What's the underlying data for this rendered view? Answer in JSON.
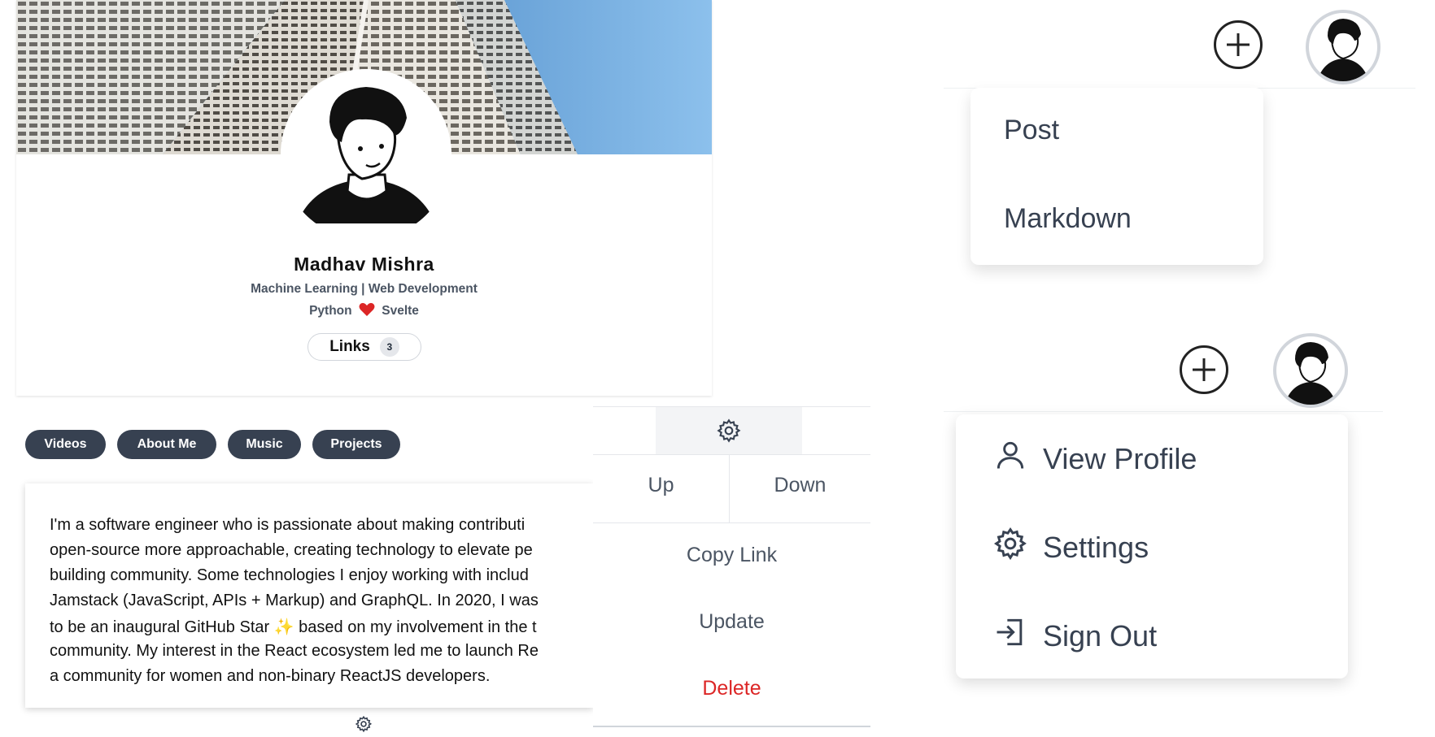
{
  "profile": {
    "name": "Madhav Mishra",
    "subtitle": "Machine Learning | Web Development",
    "tag_left": "Python",
    "tag_right": "Svelte",
    "links_label": "Links",
    "links_count": "3"
  },
  "tabs": [
    "Videos",
    "About Me",
    "Music",
    "Projects"
  ],
  "about": {
    "lines": [
      "I'm a software engineer who is passionate about making contributi",
      "open-source more approachable, creating technology to elevate pe",
      "building community. Some technologies I enjoy working with includ",
      "Jamstack (JavaScript, APIs + Markup) and GraphQL. In 2020, I was",
      "to be an inaugural GitHub Star ✨ based on my involvement in the t",
      "community. My interest in the React ecosystem led me to launch Re",
      "a community for women and non-binary ReactJS developers."
    ]
  },
  "context_menu": {
    "up": "Up",
    "down": "Down",
    "copy_link": "Copy Link",
    "update": "Update",
    "delete": "Delete"
  },
  "add_menu": {
    "items": [
      "Post",
      "Markdown"
    ]
  },
  "user_menu": {
    "items": [
      "View Profile",
      "Settings",
      "Sign Out"
    ]
  },
  "icons": {
    "gear": "gear-icon",
    "plus": "plus-circle-icon",
    "user": "user-icon",
    "signout": "sign-out-icon",
    "heart": "heart-icon"
  },
  "colors": {
    "tab_bg": "#374151",
    "delete": "#dc2626",
    "heart": "#dc2626"
  }
}
